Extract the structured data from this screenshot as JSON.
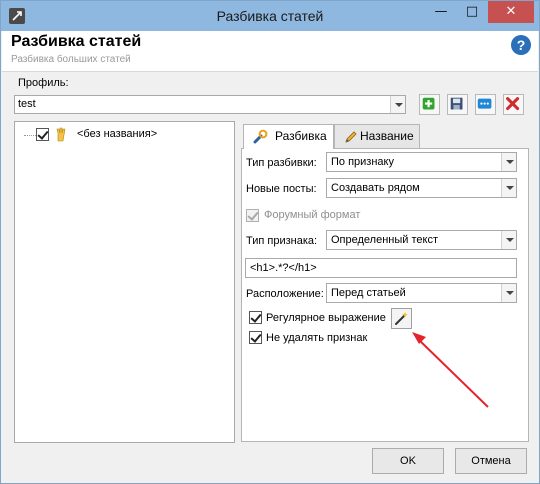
{
  "window": {
    "title": "Разбивка статей",
    "controls": {
      "minimize": "—",
      "maximize": "□",
      "close": "✕"
    }
  },
  "header": {
    "title": "Разбивка статей",
    "subtitle": "Разбивка больших статей",
    "help_icon": "help-icon"
  },
  "profile": {
    "label": "Профиль:",
    "value": "test",
    "toolbar": [
      "add-icon",
      "save-icon",
      "more-icon",
      "delete-icon"
    ]
  },
  "tree": {
    "items": [
      {
        "label": "<без названия>",
        "checked": true,
        "icon": "hand-icon"
      }
    ]
  },
  "tabs": [
    {
      "label": "Разбивка",
      "active": true,
      "icon": "wrench-icon"
    },
    {
      "label": "Название",
      "active": false,
      "icon": "pencil-icon"
    }
  ],
  "form": {
    "split_type_label": "Тип разбивки:",
    "split_type_value": "По признаку",
    "new_posts_label": "Новые посты:",
    "new_posts_value": "Создавать рядом",
    "forum_format_label": "Форумный формат",
    "forum_format_checked": true,
    "forum_format_enabled": false,
    "sign_type_label": "Тип признака:",
    "sign_type_value": "Определенный текст",
    "pattern_value": "<h1>.*?</h1>",
    "position_label": "Расположение:",
    "position_value": "Перед статьей",
    "regex_label": "Регулярное выражение",
    "regex_checked": true,
    "keep_sign_label": "Не удалять признак",
    "keep_sign_checked": true,
    "wand_icon": "magic-wand-icon"
  },
  "buttons": {
    "ok": "OK",
    "cancel": "Отмена"
  },
  "colors": {
    "titlebar": "#8fb8e0",
    "close_button": "#c75050",
    "annotation_arrow": "#e3242b"
  }
}
